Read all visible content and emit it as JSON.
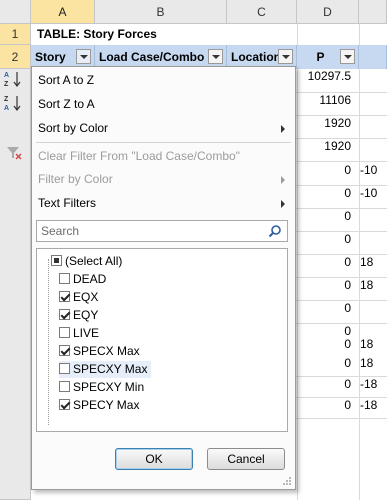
{
  "columns": [
    "A",
    "B",
    "C",
    "D"
  ],
  "rows": [
    "1",
    "2"
  ],
  "table_title": "TABLE:  Story Forces",
  "headers": {
    "story": "Story",
    "load_case": "Load Case/Combo",
    "location": "Location",
    "p": "P"
  },
  "p_values": [
    "10297.5",
    "11106",
    "1920",
    "1920",
    "0",
    "0",
    "0",
    "0",
    "0",
    "0",
    "0",
    "0",
    "0",
    "0",
    "0",
    "0",
    "0"
  ],
  "e_values": [
    "",
    "",
    "",
    "",
    "-10",
    "-10",
    "",
    "",
    "18",
    "18",
    "",
    "",
    "18",
    "18",
    "-18",
    "-18",
    ""
  ],
  "menu": {
    "sort_a_z": "Sort A to Z",
    "sort_z_a": "Sort Z to A",
    "sort_by_color": "Sort by Color",
    "clear_filter": "Clear Filter From \"Load Case/Combo\"",
    "filter_by_color": "Filter by Color",
    "text_filters": "Text Filters",
    "search_placeholder": "Search"
  },
  "filter_items": [
    {
      "label": "(Select All)",
      "state": "partial"
    },
    {
      "label": "DEAD",
      "state": "unchecked"
    },
    {
      "label": "EQX",
      "state": "checked"
    },
    {
      "label": "EQY",
      "state": "checked"
    },
    {
      "label": "LIVE",
      "state": "unchecked"
    },
    {
      "label": "SPECX Max",
      "state": "checked"
    },
    {
      "label": "SPECXY Max",
      "state": "unchecked"
    },
    {
      "label": "SPECXY Min",
      "state": "unchecked"
    },
    {
      "label": "SPECY Max",
      "state": "checked"
    }
  ],
  "buttons": {
    "ok": "OK",
    "cancel": "Cancel"
  }
}
